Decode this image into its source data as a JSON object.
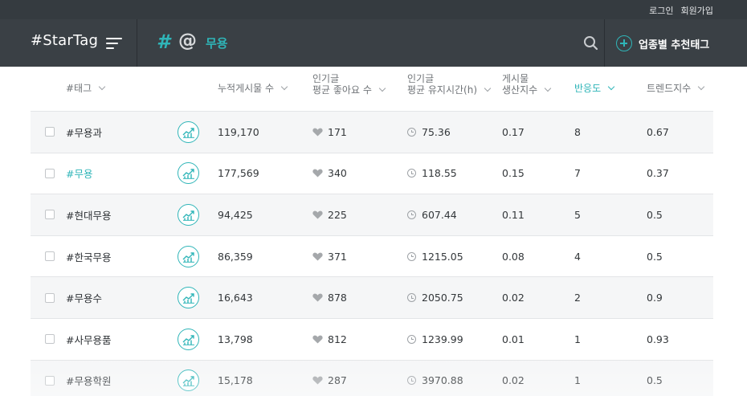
{
  "top_links": [
    "로그인",
    "회원가입"
  ],
  "header": {
    "logo": "#StarTag",
    "keyword": "무용",
    "recommend_label": "업종별 추천태그",
    "icons": [
      "menu-icon",
      "hashtag-icon",
      "at-icon",
      "search-icon",
      "plus-circle-icon"
    ]
  },
  "colors": {
    "accent": "#2fb5b8",
    "header_bg": "#3a4045",
    "topbar_bg": "#353b40"
  },
  "columns": {
    "tag": "#태그",
    "total_posts": "누적게시물 수",
    "avg_likes_l1": "인기글",
    "avg_likes_l2": "평균 좋아요 수",
    "avg_time_l1": "인기글",
    "avg_time_l2": "평균 유지시간(h)",
    "production_l1": "게시물",
    "production_l2": "생산지수",
    "response": "반응도",
    "trend": "트렌드지수"
  },
  "rows": [
    {
      "tag": "#무용과",
      "total": "119,170",
      "likes": "171",
      "time": "75.36",
      "prod": "0.17",
      "resp": "8",
      "trend": "0.67"
    },
    {
      "tag": "#무용",
      "total": "177,569",
      "likes": "340",
      "time": "118.55",
      "prod": "0.15",
      "resp": "7",
      "trend": "0.37"
    },
    {
      "tag": "#현대무용",
      "total": "94,425",
      "likes": "225",
      "time": "607.44",
      "prod": "0.11",
      "resp": "5",
      "trend": "0.5"
    },
    {
      "tag": "#한국무용",
      "total": "86,359",
      "likes": "371",
      "time": "1215.05",
      "prod": "0.08",
      "resp": "4",
      "trend": "0.5"
    },
    {
      "tag": "#무용수",
      "total": "16,643",
      "likes": "878",
      "time": "2050.75",
      "prod": "0.02",
      "resp": "2",
      "trend": "0.9"
    },
    {
      "tag": "#사무용품",
      "total": "13,798",
      "likes": "812",
      "time": "1239.99",
      "prod": "0.01",
      "resp": "1",
      "trend": "0.93"
    },
    {
      "tag": "#무용학원",
      "total": "15,178",
      "likes": "287",
      "time": "3970.88",
      "prod": "0.02",
      "resp": "1",
      "trend": "0.5"
    }
  ]
}
